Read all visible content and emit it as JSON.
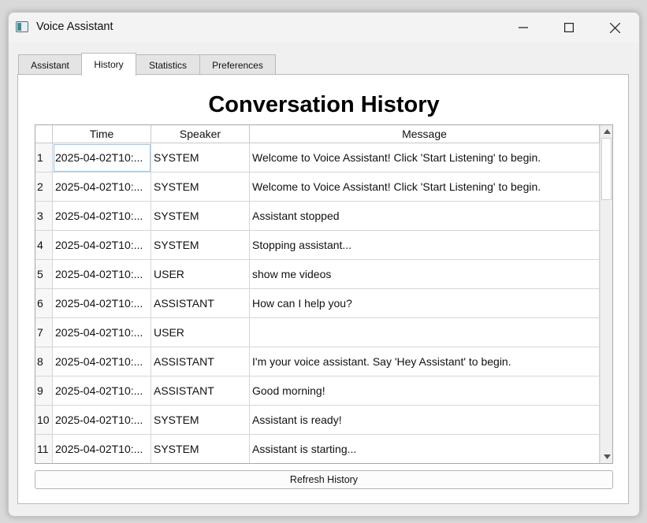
{
  "window": {
    "title": "Voice Assistant"
  },
  "tabs": [
    {
      "label": "Assistant"
    },
    {
      "label": "History",
      "active": true
    },
    {
      "label": "Statistics"
    },
    {
      "label": "Preferences"
    }
  ],
  "history": {
    "heading": "Conversation History",
    "columns": [
      "Time",
      "Speaker",
      "Message"
    ],
    "rows": [
      {
        "num": "1",
        "time": "2025-04-02T10:...",
        "speaker": "SYSTEM",
        "message": "Welcome to Voice Assistant! Click 'Start Listening' to begin."
      },
      {
        "num": "2",
        "time": "2025-04-02T10:...",
        "speaker": "SYSTEM",
        "message": "Welcome to Voice Assistant! Click 'Start Listening' to begin."
      },
      {
        "num": "3",
        "time": "2025-04-02T10:...",
        "speaker": "SYSTEM",
        "message": "Assistant stopped"
      },
      {
        "num": "4",
        "time": "2025-04-02T10:...",
        "speaker": "SYSTEM",
        "message": "Stopping assistant..."
      },
      {
        "num": "5",
        "time": "2025-04-02T10:...",
        "speaker": "USER",
        "message": "show me videos"
      },
      {
        "num": "6",
        "time": "2025-04-02T10:...",
        "speaker": "ASSISTANT",
        "message": "How can I help you?"
      },
      {
        "num": "7",
        "time": "2025-04-02T10:...",
        "speaker": "USER",
        "message": ""
      },
      {
        "num": "8",
        "time": "2025-04-02T10:...",
        "speaker": "ASSISTANT",
        "message": "I'm your voice assistant. Say 'Hey Assistant' to begin."
      },
      {
        "num": "9",
        "time": "2025-04-02T10:...",
        "speaker": "ASSISTANT",
        "message": "Good morning!"
      },
      {
        "num": "10",
        "time": "2025-04-02T10:...",
        "speaker": "SYSTEM",
        "message": "Assistant is ready!"
      },
      {
        "num": "11",
        "time": "2025-04-02T10:...",
        "speaker": "SYSTEM",
        "message": "Assistant is starting..."
      }
    ],
    "refresh_label": "Refresh History"
  },
  "icons": {
    "app": "app-window-icon",
    "minimize": "minimize-icon",
    "maximize": "maximize-icon",
    "close": "close-icon",
    "scroll_up": "scroll-up-arrow-icon",
    "scroll_down": "scroll-down-arrow-icon"
  }
}
